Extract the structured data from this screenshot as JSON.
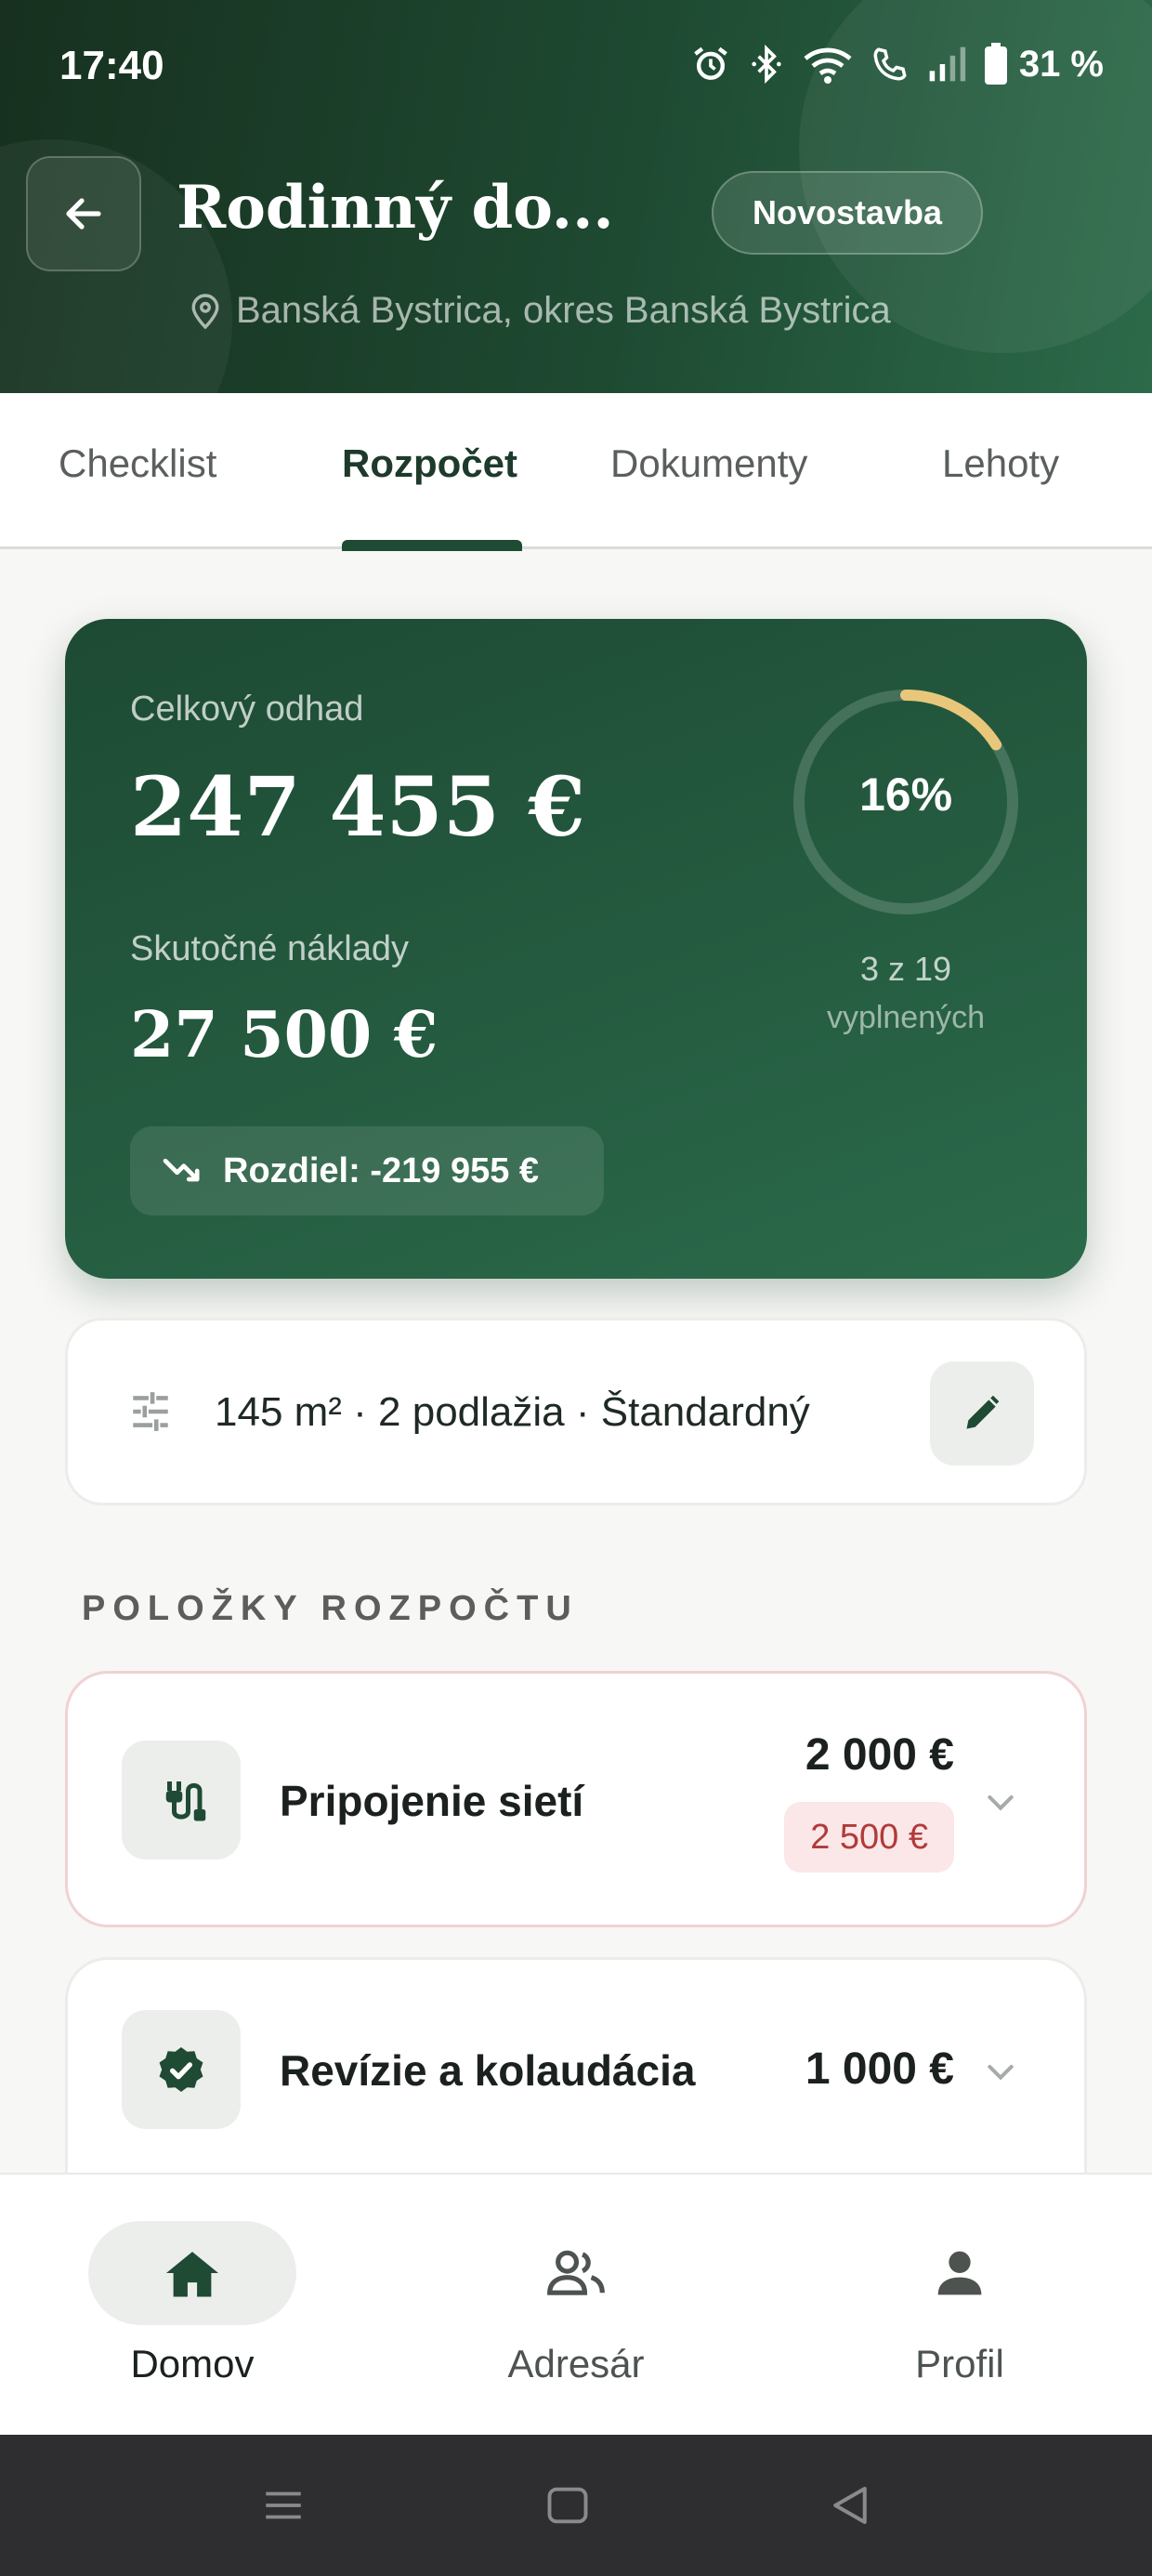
{
  "status_bar": {
    "time": "17:40",
    "battery": "31 %"
  },
  "header": {
    "title": "Rodinný do...",
    "type_chip": "Novostavba",
    "location": "Banská Bystrica, okres Banská Bystrica"
  },
  "tabs": [
    {
      "label": "Checklist"
    },
    {
      "label": "Rozpočet"
    },
    {
      "label": "Dokumenty"
    },
    {
      "label": "Lehoty"
    }
  ],
  "active_tab": "Rozpočet",
  "summary": {
    "estimate_label": "Celkový odhad",
    "estimate_value": "247 455 €",
    "actual_label": "Skutočné náklady",
    "actual_value": "27 500 €",
    "difference": "Rozdiel: -219 955 €",
    "progress_percent": "16%",
    "progress_fraction": 0.16,
    "progress_count": "3 z 19",
    "progress_sub": "vyplnených"
  },
  "params": {
    "text": "145 m² · 2 podlažia · Štandardný"
  },
  "section_title": "POLOŽKY ROZPOČTU",
  "items": [
    {
      "name": "Pripojenie sietí",
      "amount": "2 000 €",
      "actual": "2 500 €"
    },
    {
      "name": "Revízie a kolaudácia",
      "amount": "1 000 €"
    }
  ],
  "bottom_nav": [
    {
      "label": "Domov"
    },
    {
      "label": "Adresár"
    },
    {
      "label": "Profil"
    }
  ],
  "colors": {
    "primary_green": "#1f4a33",
    "accent_gold": "#e8c77a",
    "overrun_red": "#b23a3a"
  }
}
